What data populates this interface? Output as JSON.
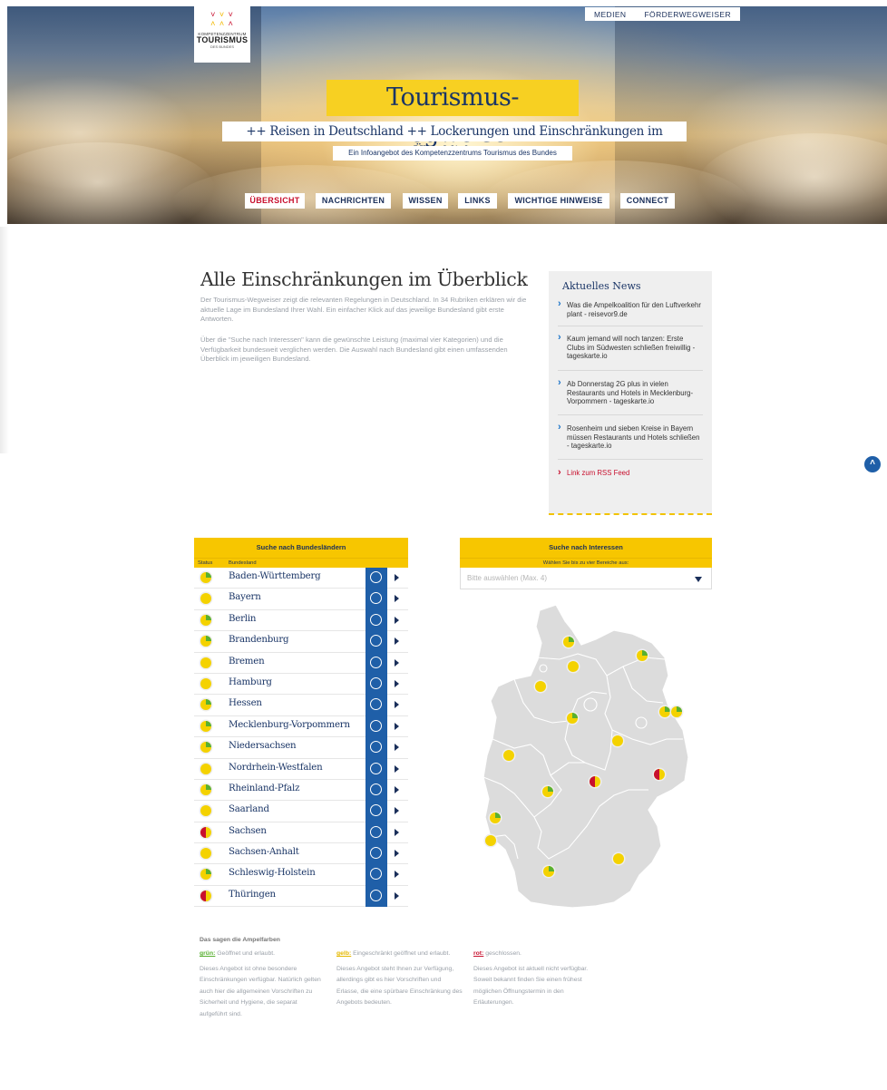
{
  "logo": {
    "line1": "KOMPETENZZENTRUM",
    "line2": "TOURISMUS",
    "line3": "DES BUNDES"
  },
  "topnav": [
    "MEDIEN",
    "FÖRDERWEGWEISER"
  ],
  "hero": {
    "title": "Tourismus-Wegweiser",
    "subtitle": "++ Reisen in Deutschland ++ Lockerungen und Einschränkungen im Überblick ++",
    "tagline": "Ein Infoangebot des Kompetenzzentrums Tourismus des Bundes"
  },
  "mainnav": [
    "ÜBERSICHT",
    "NACHRICHTEN",
    "WISSEN",
    "LINKS",
    "WICHTIGE HINWEISE",
    "CONNECT"
  ],
  "intro": {
    "title": "Alle Einschränkungen im Überblick",
    "p1": "Der Tourismus-Wegweiser zeigt die relevanten Regelungen in Deutschland. In 34 Rubriken erklären wir die aktuelle Lage im Bundesland Ihrer Wahl. Ein einfacher Klick auf das jeweilige Bundesland gibt erste Antworten.",
    "p2": "Über die \"Suche nach Interessen\" kann die gewünschte Leistung (maximal vier Kategorien) und die Verfügbarkeit bundesweit verglichen werden. Die Auswahl nach Bundesland gibt einen umfassenden Überblick im jeweiligen Bundesland."
  },
  "news": {
    "heading": "Aktuelles News",
    "items": [
      "Was die Ampelkoalition für den Luftverkehr plant - reisevor9.de",
      "Kaum jemand will noch tanzen: Erste Clubs im Südwesten schließen freiwillig - tageskarte.io",
      "Ab Donnerstag 2G plus in vielen Restaurants und Hotels in Mecklenburg-Vorpommern - tageskarte.io",
      "Rosenheim und sieben Kreise in Bayern müssen Restaurants und Hotels schließen - tageskarte.io"
    ],
    "rss": "Link zum RSS Feed"
  },
  "states": {
    "heading": "Suche nach Bundesländern",
    "col_status": "Status",
    "col_state": "Bundesland",
    "rows": [
      {
        "name": "Baden-Württemberg",
        "status": "yellow-green"
      },
      {
        "name": "Bayern",
        "status": "yellow"
      },
      {
        "name": "Berlin",
        "status": "yellow-green"
      },
      {
        "name": "Brandenburg",
        "status": "yellow-green"
      },
      {
        "name": "Bremen",
        "status": "yellow"
      },
      {
        "name": "Hamburg",
        "status": "yellow"
      },
      {
        "name": "Hessen",
        "status": "yellow-green"
      },
      {
        "name": "Mecklenburg-Vorpommern",
        "status": "yellow-green"
      },
      {
        "name": "Niedersachsen",
        "status": "yellow-green"
      },
      {
        "name": "Nordrhein-Westfalen",
        "status": "yellow"
      },
      {
        "name": "Rheinland-Pfalz",
        "status": "yellow-green"
      },
      {
        "name": "Saarland",
        "status": "yellow"
      },
      {
        "name": "Sachsen",
        "status": "red-yellow"
      },
      {
        "name": "Sachsen-Anhalt",
        "status": "yellow"
      },
      {
        "name": "Schleswig-Holstein",
        "status": "yellow-green"
      },
      {
        "name": "Thüringen",
        "status": "red-yellow"
      }
    ]
  },
  "interests": {
    "heading": "Suche nach Interessen",
    "sub": "Wählen Sie bis zu vier Bereiche aus:",
    "placeholder": "Bitte auswählen (Max. 4)"
  },
  "legend": {
    "heading": "Das sagen die Ampelfarben",
    "green_key": "grün:",
    "green_short": " Geöffnet und erlaubt.",
    "green_text": "Dieses Angebot ist ohne besondere Einschränkungen verfügbar. Natürlich gelten auch hier die allgemeinen Vorschriften zu Sicherheit und Hygiene, die separat aufgeführt sind.",
    "yellow_key": "gelb:",
    "yellow_short": " Eingeschränkt geöffnet und erlaubt.",
    "yellow_text": "Dieses Angebot steht Ihnen zur Verfügung, allerdings gibt es hier Vorschriften und Erlasse, die eine spürbare Einschränkung des Angebots bedeuten.",
    "red_key": "rot:",
    "red_short": " geschlossen.",
    "red_text": "Dieses Angebot ist aktuell nicht verfügbar. Soweit bekannt finden Sie einen frühest möglichen Öffnungstermin in den Erläuterungen."
  },
  "colors": {
    "brand_yellow": "#f7c600",
    "navy": "#1a3566",
    "info_blue": "#1f5fa8",
    "red": "#c8102e",
    "green": "#58b031"
  }
}
